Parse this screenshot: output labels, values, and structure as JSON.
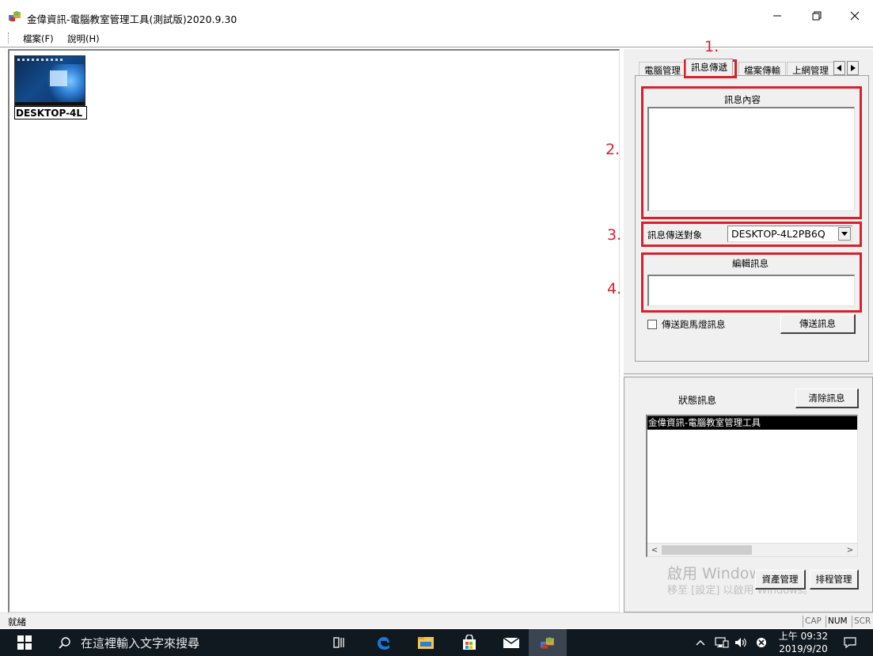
{
  "window": {
    "title": "金偉資訊-電腦教室管理工具(測試版)2020.9.30",
    "controls": {
      "minimize": "minimize-icon",
      "restore": "restore-icon",
      "close": "close-icon"
    }
  },
  "menu": [
    {
      "label": "檔案(F)"
    },
    {
      "label": "說明(H)"
    }
  ],
  "computers": [
    {
      "label": "DESKTOP-4L"
    }
  ],
  "tabs": [
    {
      "label": "電腦管理",
      "active": false
    },
    {
      "label": "訊息傳遞",
      "active": true
    },
    {
      "label": "檔案傳輸",
      "active": false
    },
    {
      "label": "上網管理",
      "active": false
    }
  ],
  "message_panel": {
    "content_label": "訊息內容",
    "content_value": "",
    "target_label": "訊息傳送對象",
    "target_value": "DESKTOP-4L2PB6Q",
    "edit_label": "編輯訊息",
    "edit_value": "",
    "marquee_checkbox_label": "傳送跑馬燈訊息",
    "marquee_checked": false,
    "send_button": "傳送訊息"
  },
  "callouts": [
    "1.",
    "2.",
    "3.",
    "4."
  ],
  "status_panel": {
    "title": "狀態訊息",
    "clear_button": "清除訊息",
    "lines": [
      "金偉資訊-電腦教室管理工具"
    ],
    "asset_button": "資產管理",
    "schedule_button": "排程管理"
  },
  "watermark": {
    "line1": "啟用 Windows",
    "line2": "移至 [設定] 以啟用 Windows。"
  },
  "statusbar": {
    "ready": "就緒",
    "indicators": [
      "CAP",
      "NUM",
      "SCR"
    ]
  },
  "taskbar": {
    "search_placeholder": "在這裡輸入文字來搜尋",
    "clock_time": "上午 09:32",
    "clock_date": "2019/9/20"
  },
  "colors": {
    "annotation_red": "#d9202b",
    "panel_bg": "#f0f0f0",
    "taskbar_bg": "#101820",
    "edge_blue": "#1f74d6"
  }
}
